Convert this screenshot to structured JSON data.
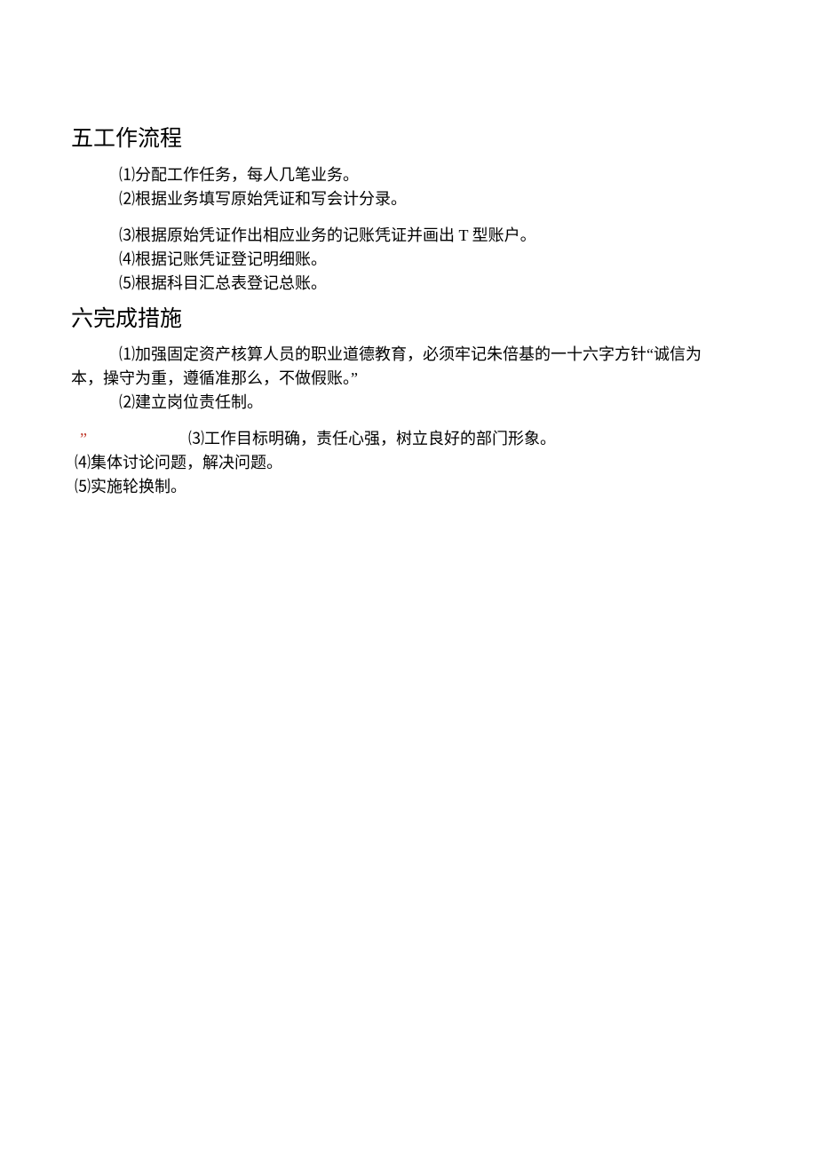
{
  "section5": {
    "heading": "五工作流程",
    "items": [
      "⑴分配工作任务，每人几笔业务。",
      "⑵根据业务填写原始凭证和写会计分录。",
      "⑶根据原始凭证作出相应业务的记账凭证并画出 T 型账户。",
      "⑷根据记账凭证登记明细账。",
      "⑸根据科目汇总表登记总账。"
    ]
  },
  "section6": {
    "heading": "六完成措施",
    "item1_line1": "⑴加强固定资产核算人员的职业道德教育，必须牢记朱倍基的一十六字方针“诚信为",
    "item1_line2": "本，操守为重，遵循准那么，不做假账。”",
    "item2": "⑵建立岗位责任制。",
    "quote": "”",
    "item3": "⑶工作目标明确，责任心强，树立良好的部门形象。",
    "item4": "⑷集体讨论问题，解决问题。",
    "item5": "⑸实施轮换制。"
  }
}
